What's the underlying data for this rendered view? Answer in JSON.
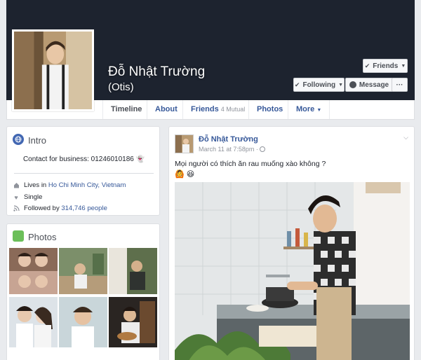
{
  "profile": {
    "name": "Đỗ Nhật Trường",
    "alternate_name": "(Otis)"
  },
  "actions": {
    "friends_label": "Friends",
    "following_label": "Following",
    "message_label": "Message",
    "more_label": "···"
  },
  "tabs": {
    "timeline": "Timeline",
    "about": "About",
    "friends": "Friends",
    "friends_mutual": "4 Mutual",
    "photos": "Photos",
    "more": "More"
  },
  "intro": {
    "title": "Intro",
    "contact": "Contact for business: 01246010186",
    "lives_in_prefix": "Lives in",
    "lives_in_city": "Ho Chi Minh City, Vietnam",
    "relationship": "Single",
    "followed_by_prefix": "Followed by",
    "followed_by_count": "314,746 people"
  },
  "photos_card": {
    "title": "Photos"
  },
  "post": {
    "author": "Đỗ Nhật Trường",
    "timestamp": "March 11 at 7:58pm ·",
    "text": "Mọi người có thích ăn rau muống xào không ?",
    "emojis": "🙆 😆"
  },
  "colors": {
    "cover": "#1d232f",
    "link": "#365899",
    "background": "#e9ebee"
  }
}
